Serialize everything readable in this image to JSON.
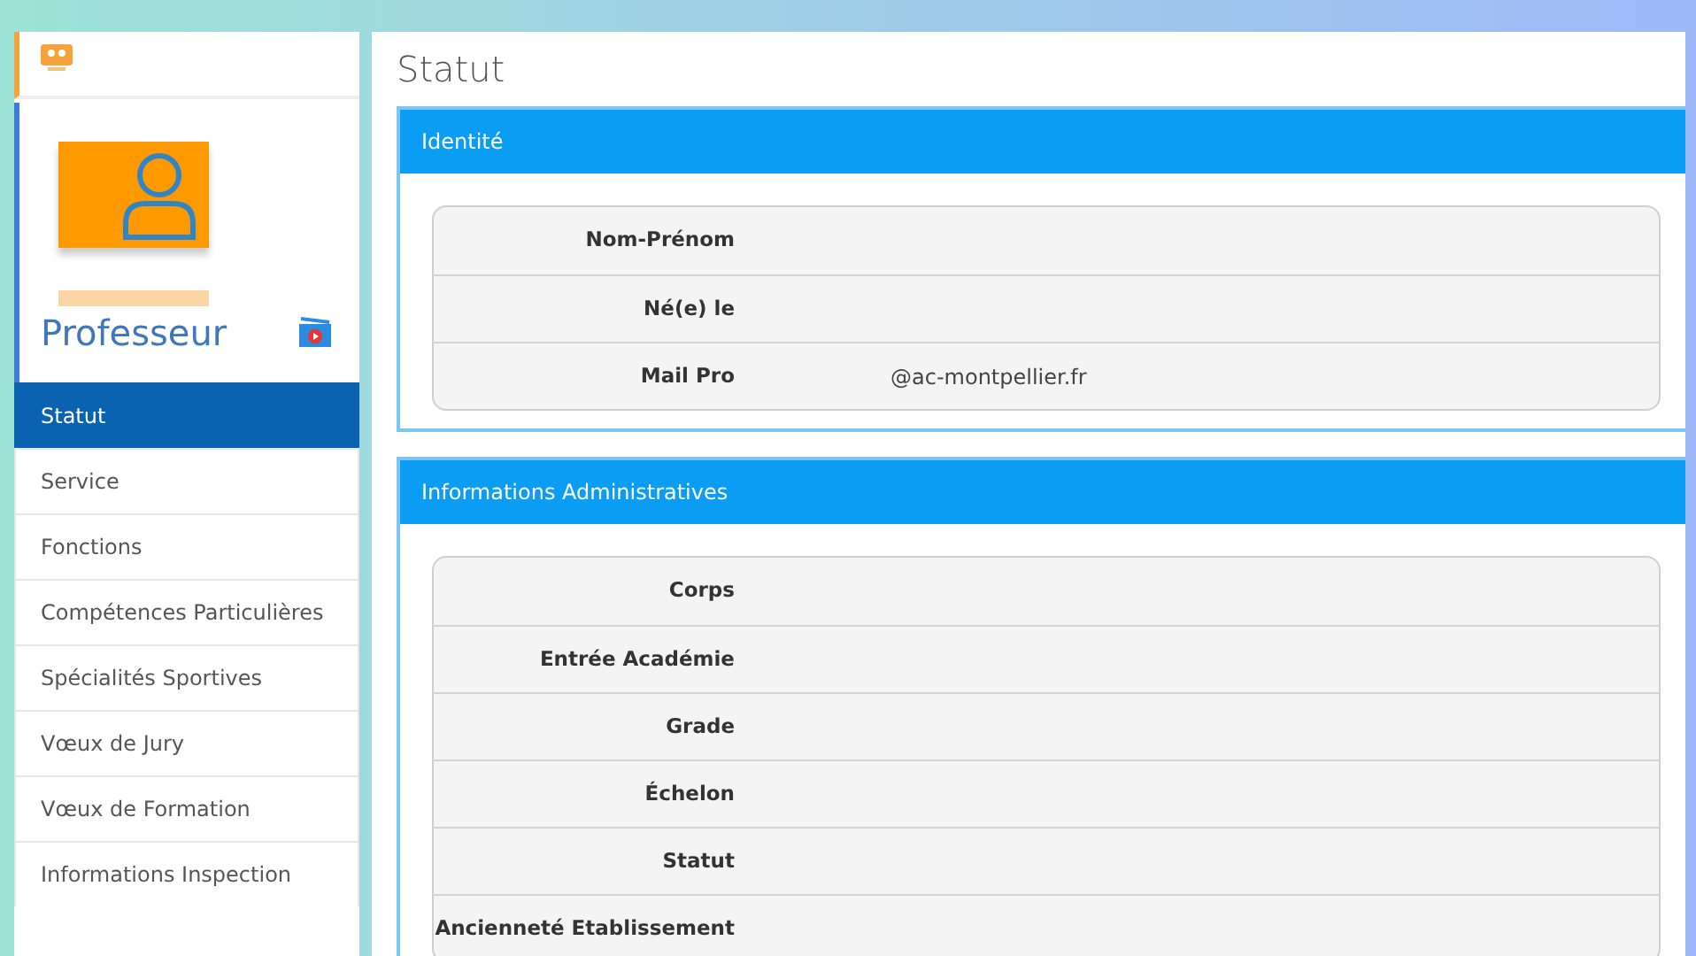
{
  "sidebar": {
    "role": "Professeur",
    "items": [
      {
        "label": "Statut",
        "selected": true
      },
      {
        "label": "Service",
        "selected": false
      },
      {
        "label": "Fonctions",
        "selected": false
      },
      {
        "label": "Compétences Particulières",
        "selected": false
      },
      {
        "label": "Spécialités Sportives",
        "selected": false
      },
      {
        "label": "Vœux de Jury",
        "selected": false
      },
      {
        "label": "Vœux de Formation",
        "selected": false
      },
      {
        "label": "Informations Inspection",
        "selected": false
      }
    ]
  },
  "page_title": "Statut",
  "panels": [
    {
      "title": "Identité",
      "rows": [
        {
          "label": "Nom-Prénom"
        },
        {
          "label": "Né(e) le"
        },
        {
          "label": "Mail Pro",
          "value": "@ac-montpellier.fr"
        }
      ]
    },
    {
      "title": "Informations Administratives",
      "rows": [
        {
          "label": "Corps"
        },
        {
          "label": "Entrée Académie"
        },
        {
          "label": "Grade"
        },
        {
          "label": "Échelon"
        },
        {
          "label": "Statut"
        },
        {
          "label": "Ancienneté Etablissement"
        }
      ]
    }
  ]
}
